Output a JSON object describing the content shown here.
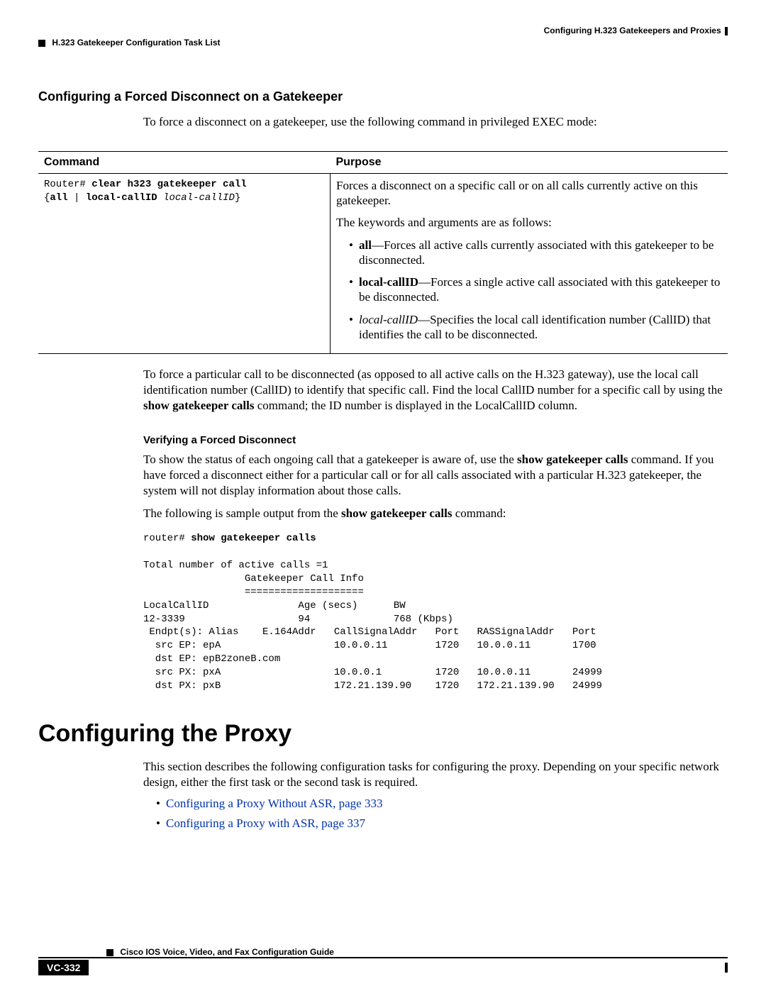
{
  "header": {
    "chapter": "Configuring H.323 Gatekeepers and Proxies",
    "section_path": "H.323 Gatekeeper Configuration Task List"
  },
  "section1": {
    "heading": "Configuring a Forced Disconnect on a Gatekeeper",
    "intro": "To force a disconnect on a gatekeeper, use the following command in privileged EXEC mode:"
  },
  "table": {
    "col1_header": "Command",
    "col2_header": "Purpose",
    "cmd_prompt": "Router# ",
    "cmd_bold": "clear h323 gatekeeper call",
    "cmd_line2a": "{",
    "cmd_line2b": "all",
    "cmd_line2c": " | ",
    "cmd_line2d": "local-callID",
    "cmd_line2e_italic": " local-callID",
    "cmd_line2f": "}",
    "purpose_p1": "Forces a disconnect on a specific call or on all calls currently active on this gatekeeper.",
    "purpose_p2": "The keywords and arguments are as follows:",
    "bullets": {
      "b1_key": "all",
      "b1_rest": "—Forces all active calls currently associated with this gatekeeper to be disconnected.",
      "b2_key": "local-callID",
      "b2_rest": "—Forces a single active call associated with this gatekeeper to be disconnected.",
      "b3_key_italic": "local-callID",
      "b3_rest": "—Specifies the local call identification number (CallID) that identifies the call to be disconnected."
    }
  },
  "para_after_table": {
    "t1": "To force a particular call to be disconnected (as opposed to all active calls on the H.323 gateway), use the local call identification number (CallID) to identify that specific call. Find the local CallID number for a specific call by using the ",
    "t1_bold": "show gatekeeper calls",
    "t1_after": " command; the ID number is displayed in the LocalCallID column."
  },
  "sub_heading": "Verifying a Forced Disconnect",
  "verify_p1a": "To show the status of each ongoing call that a gatekeeper is aware of, use the ",
  "verify_p1b_bold": "show gatekeeper calls",
  "verify_p1c": " command. If you have forced a disconnect either for a particular call or for all calls associated with a particular H.323 gatekeeper, the system will not display information about those calls.",
  "verify_p2a": "The following is sample output from the ",
  "verify_p2b_bold": "show gatekeeper calls",
  "verify_p2c": " command:",
  "terminal": {
    "prompt": "router# ",
    "cmd_bold": "show gatekeeper calls",
    "body": "Total number of active calls =1\n                 Gatekeeper Call Info\n                 ====================\nLocalCallID               Age (secs)      BW\n12-3339                   94              768 (Kbps)\n Endpt(s): Alias    E.164Addr   CallSignalAddr   Port   RASSignalAddr   Port\n  src EP: epA                   10.0.0.11        1720   10.0.0.11       1700\n  dst EP: epB2zoneB.com\n  src PX: pxA                   10.0.0.1         1720   10.0.0.11       24999\n  dst PX: pxB                   172.21.139.90    1720   172.21.139.90   24999"
  },
  "section2": {
    "heading": "Configuring the Proxy",
    "intro": "This section describes the following configuration tasks for configuring the proxy. Depending on your specific network design, either the first task or the second task is required."
  },
  "links": {
    "l1": "Configuring a Proxy Without ASR, page 333",
    "l2": "Configuring a Proxy with ASR, page 337"
  },
  "footer": {
    "guide": "Cisco IOS Voice, Video, and Fax Configuration Guide",
    "page_number": "VC-332"
  },
  "chart_data": null
}
